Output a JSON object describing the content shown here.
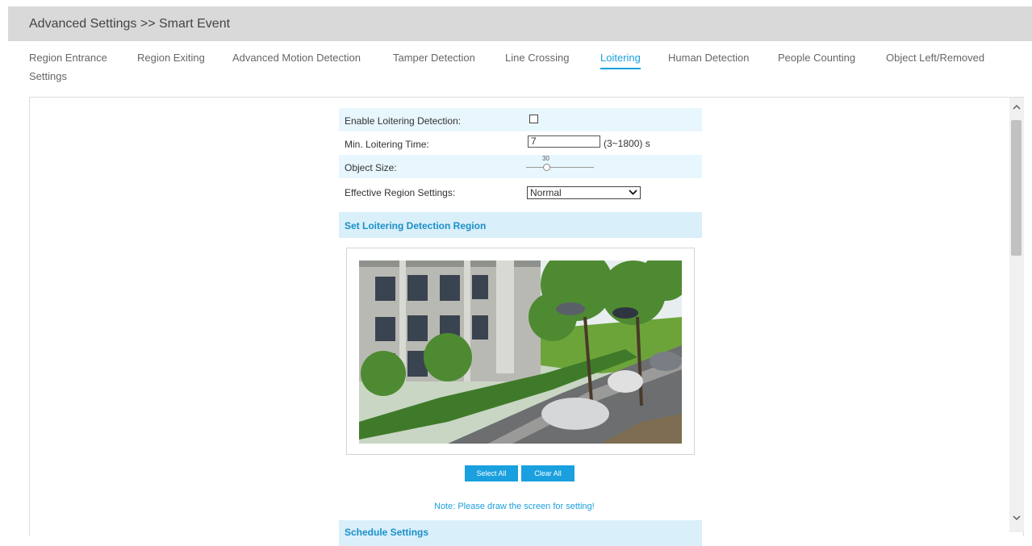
{
  "header": {
    "title": "Advanced Settings >> Smart Event"
  },
  "tabs": [
    {
      "label": "Region Entrance"
    },
    {
      "label": "Region Exiting"
    },
    {
      "label": "Advanced Motion Detection"
    },
    {
      "label": "Tamper Detection"
    },
    {
      "label": "Line Crossing"
    },
    {
      "label": "Loitering",
      "active": true
    },
    {
      "label": "Human Detection"
    },
    {
      "label": "People Counting"
    },
    {
      "label": "Object Left/Removed"
    }
  ],
  "tabs_wrap": "Settings",
  "form": {
    "enable_label": "Enable Loitering Detection:",
    "enable_checked": false,
    "min_time_label": "Min. Loitering Time:",
    "min_time_value": "7",
    "min_time_range": "(3~1800) s",
    "object_size_label": "Object Size:",
    "object_size_value": "30",
    "region_settings_label": "Effective Region Settings:",
    "region_settings_value": "Normal"
  },
  "region": {
    "title": "Set Loitering Detection Region",
    "select_all": "Select All",
    "clear_all": "Clear All",
    "note": "Note: Please draw the screen for setting!"
  },
  "schedule": {
    "title": "Schedule Settings"
  },
  "colors": {
    "accent": "#1aa0de",
    "row_alt": "#e8f6fd",
    "section_bg": "#d9eff9",
    "header_bg": "#d9d9d9"
  }
}
